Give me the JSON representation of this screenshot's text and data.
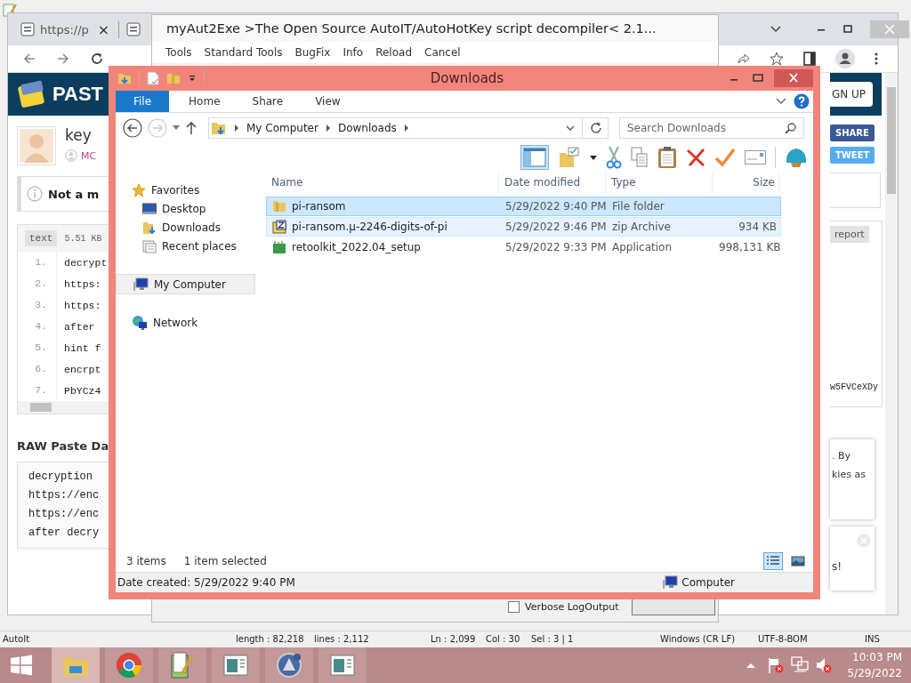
{
  "notepad": {
    "status": [
      "AutoIt",
      "length : 82,218",
      "lines : 2,112",
      "Ln : 2,099",
      "Col : 30",
      "Sel : 3 | 1",
      "Windows (CR LF)",
      "UTF-8-BOM",
      "INS"
    ]
  },
  "browser": {
    "tabs": [
      {
        "kind": "titled",
        "title": "https://p",
        "close": "×"
      },
      {
        "kind": "icon-only"
      }
    ],
    "page": {
      "logo": "PAST",
      "sign_up": "GN UP",
      "user": "key",
      "user_link": "MC",
      "notice": "Not a m",
      "share": "SHARE",
      "tweet": "TWEET",
      "paste": {
        "type": "text",
        "size": "5.51 KB",
        "report": "report",
        "tail": "w5FVCeXDy",
        "lines": [
          {
            "n": "1.",
            "text": "decrypt"
          },
          {
            "n": "2.",
            "text": "https:"
          },
          {
            "n": "3.",
            "text": "https:"
          },
          {
            "n": "4.",
            "text": "after"
          },
          {
            "n": "5.",
            "text": "hint f"
          },
          {
            "n": "6.",
            "text": "encrpt"
          },
          {
            "n": "7.",
            "text": "PbYCz4"
          }
        ]
      },
      "raw_heading": "RAW Paste Da",
      "raw_lines": [
        "decryption",
        "https://enc",
        "https://enc",
        "after decry"
      ],
      "cookie": [
        ". By",
        "kies as"
      ],
      "toast": "s!"
    }
  },
  "aut2exe": {
    "title": "myAut2Exe >The Open Source AutoIT/AutoHotKey script decompiler< 2.1...",
    "menu": [
      "Tools",
      "Standard Tools",
      "BugFix",
      "Info",
      "Reload",
      "Cancel"
    ],
    "verbose": {
      "label": "Verbose LogOutput",
      "checked": false
    }
  },
  "explorer": {
    "title": "Downloads",
    "ribbon_tabs": [
      {
        "label": "File",
        "selected": true
      },
      {
        "label": "Home",
        "selected": false
      },
      {
        "label": "Share",
        "selected": false
      },
      {
        "label": "View",
        "selected": false
      }
    ],
    "address": [
      "My Computer",
      "Downloads"
    ],
    "search": {
      "placeholder": "Search Downloads"
    },
    "nav": [
      {
        "label": "Favorites",
        "kind": "favorites",
        "selected": false,
        "children": [
          {
            "label": "Desktop",
            "kind": "desktop",
            "selected": false
          },
          {
            "label": "Downloads",
            "kind": "downloads",
            "selected": false
          },
          {
            "label": "Recent places",
            "kind": "recent",
            "selected": false
          }
        ]
      },
      {
        "label": "My Computer",
        "kind": "computer",
        "selected": true
      },
      {
        "label": "Network",
        "kind": "network",
        "selected": false
      }
    ],
    "columns": [
      "Name",
      "Date modified",
      "Type",
      "Size"
    ],
    "rows": [
      {
        "kind": "folder",
        "name": "pi-ransom",
        "date": "5/29/2022 9:40 PM",
        "type": "File folder",
        "size": "",
        "selected": true,
        "hovered": false
      },
      {
        "kind": "zip",
        "name": "pi-ransom.µ-2246-digits-of-pi",
        "date": "5/29/2022 9:46 PM",
        "type": "zip Archive",
        "size": "934 KB",
        "selected": false,
        "hovered": true
      },
      {
        "kind": "app",
        "name": "retoolkit_2022.04_setup",
        "date": "5/29/2022 9:33 PM",
        "type": "Application",
        "size": "998,131 KB",
        "selected": false,
        "hovered": false
      }
    ],
    "item_count": "3 items",
    "selection": "1 item selected",
    "views": [
      {
        "kind": "details",
        "selected": true
      },
      {
        "kind": "large-icons",
        "selected": false
      }
    ],
    "details": "Date created: 5/29/2022 9:40 PM",
    "location": "Computer"
  },
  "taskbar": {
    "apps": [
      {
        "kind": "folder",
        "active": true
      },
      {
        "kind": "round-logo",
        "active": false
      },
      {
        "kind": "notepad",
        "active": false
      },
      {
        "kind": "window",
        "active": false
      },
      {
        "kind": "emblem",
        "active": false
      },
      {
        "kind": "window",
        "active": false
      }
    ],
    "time": "10:03 PM",
    "date": "5/29/2022"
  }
}
